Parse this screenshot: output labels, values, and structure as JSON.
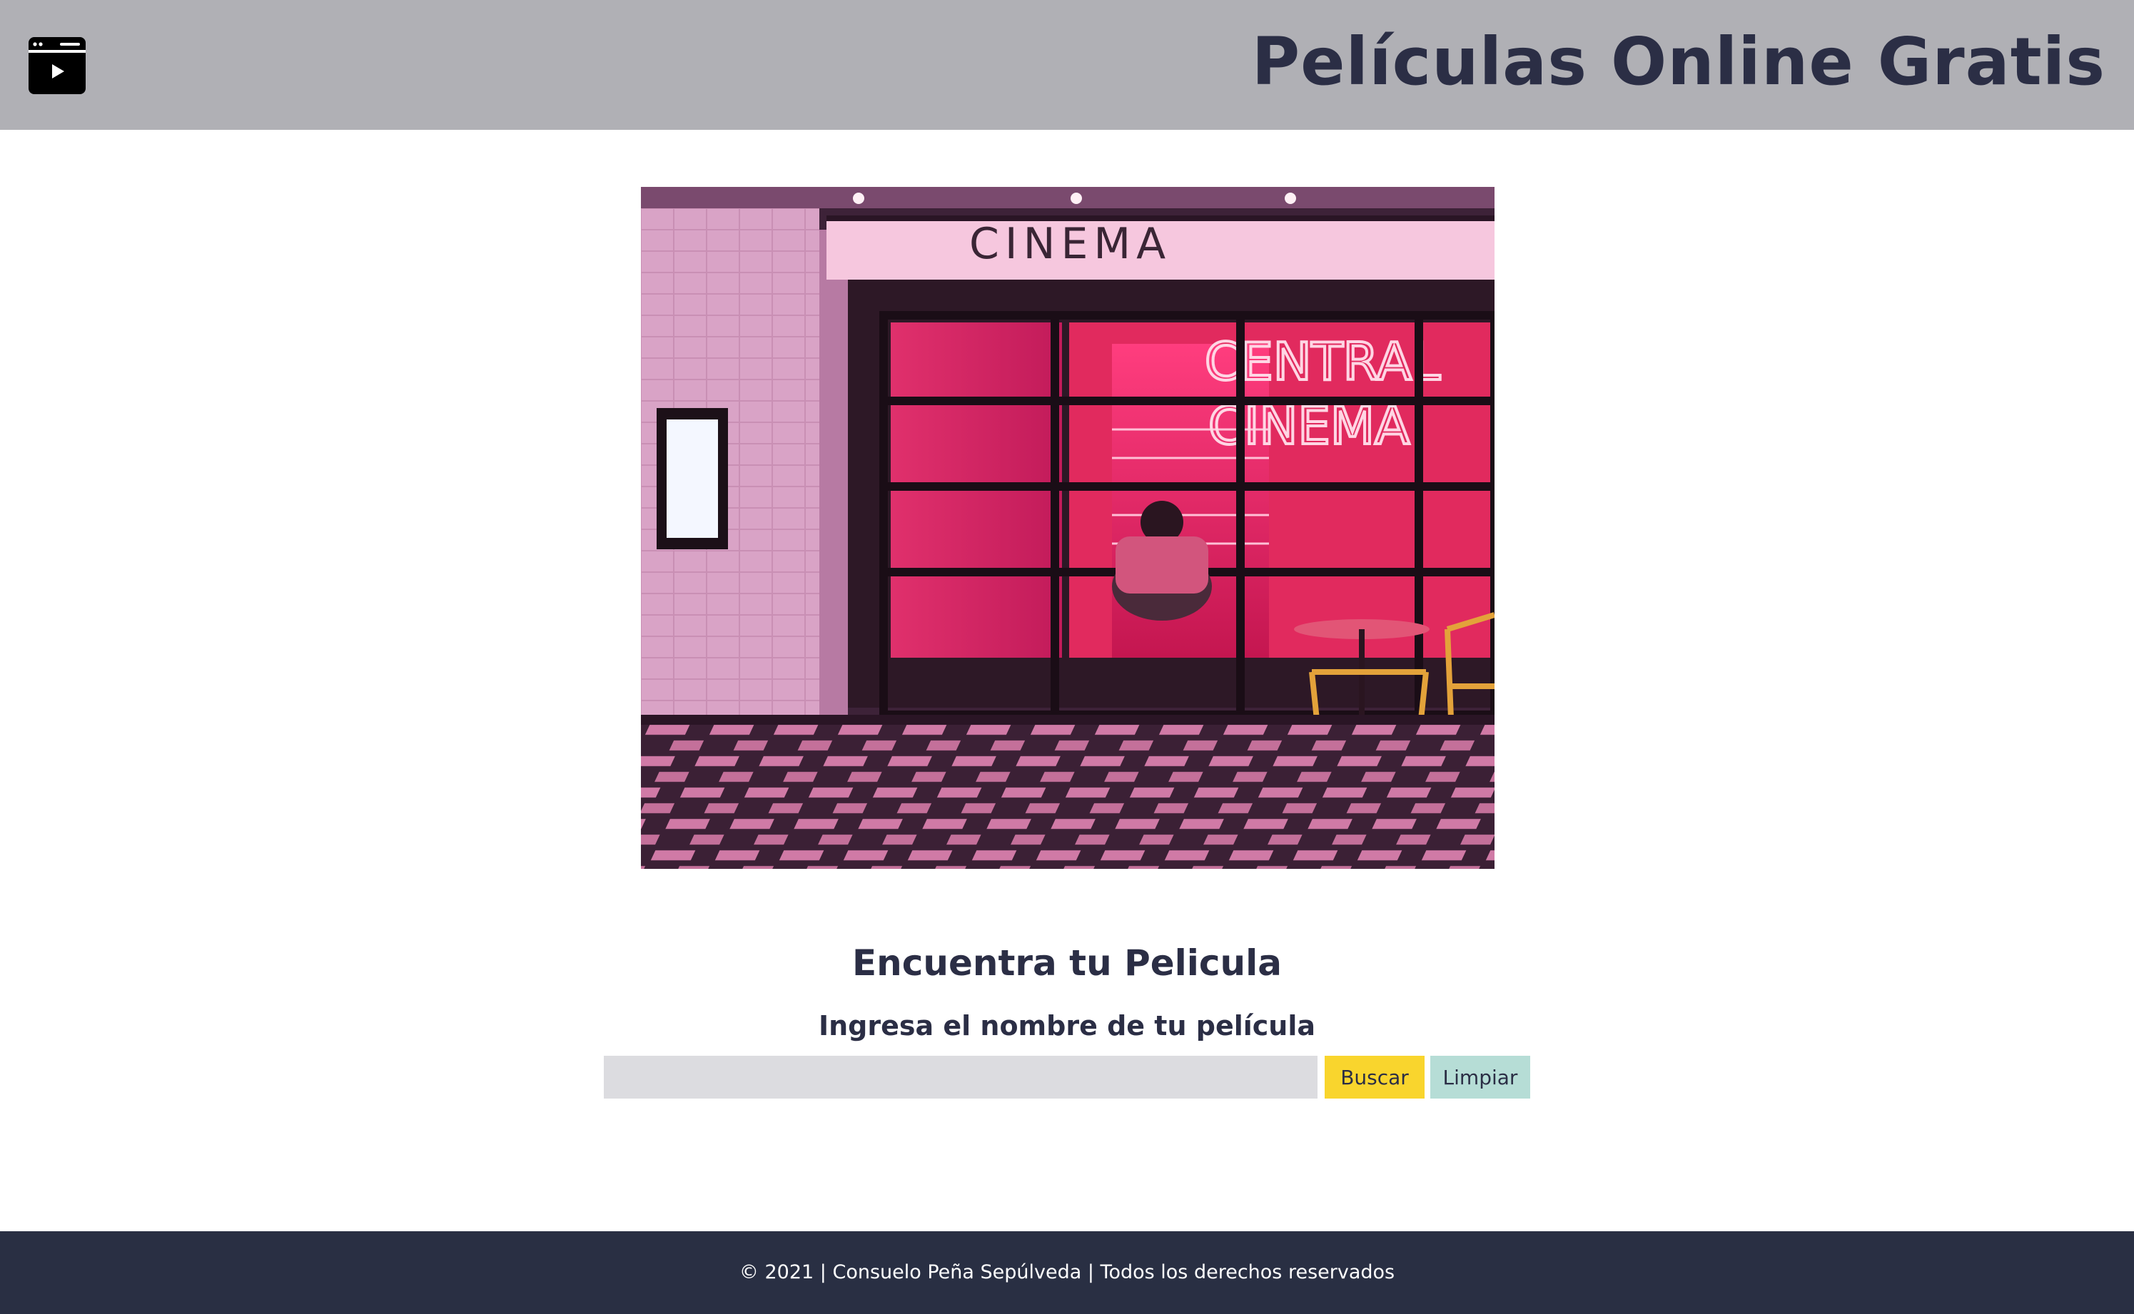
{
  "header": {
    "logo_icon": "video-player-icon",
    "title": "Películas Online Gratis",
    "background": "#b0b0b5",
    "title_color": "#2b2e45"
  },
  "hero": {
    "image": "cinema-storefront-photo",
    "sign_top": "CINEMA",
    "neon_line1": "CENTRAL",
    "neon_line2": "CINEMA"
  },
  "search": {
    "heading": "Encuentra tu Pelicula",
    "prompt": "Ingresa el nombre de tu película",
    "input_value": "",
    "input_placeholder": "",
    "search_button_label": "Buscar",
    "clear_button_label": "Limpiar",
    "search_button_color": "#f9d52d",
    "clear_button_color": "#b6ddd6"
  },
  "footer": {
    "text": "© 2021 | Consuelo Peña Sepúlveda | Todos los derechos reservados",
    "background": "#292f43"
  }
}
